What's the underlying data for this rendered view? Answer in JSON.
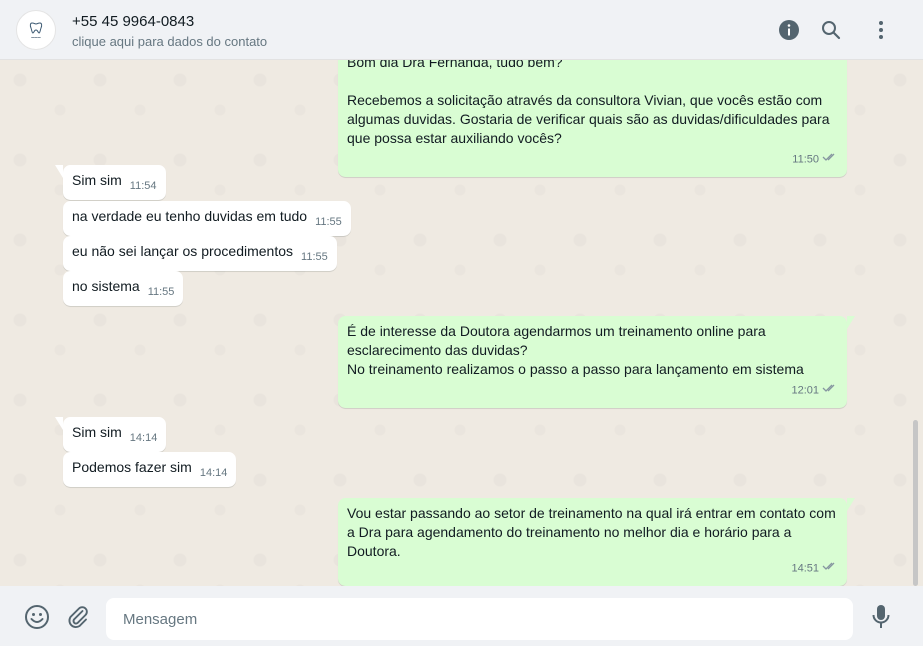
{
  "header": {
    "contact_name": "+55 45 9964-0843",
    "contact_subtitle": "clique aqui para dados do contato",
    "avatar_icon": "tooth-logo",
    "icons": [
      "info-icon",
      "search-icon",
      "menu-dots-icon"
    ]
  },
  "messages": [
    {
      "dir": "out",
      "text": "Bom dia Dra Fernanda, tudo bem?\n\nRecebemos a solicitação através da consultora Vivian, que vocês estão com algumas duvidas. Gostaria de verificar quais são as duvidas/dificuldades para que possa estar auxiliando vocês?",
      "time": "11:50"
    },
    {
      "dir": "in",
      "text": "Sim sim",
      "time": "11:54"
    },
    {
      "dir": "in",
      "text": "na verdade eu tenho duvidas em tudo",
      "time": "11:55"
    },
    {
      "dir": "in",
      "text": "eu não sei lançar os procedimentos",
      "time": "11:55"
    },
    {
      "dir": "in",
      "text": "no sistema",
      "time": "11:55"
    },
    {
      "dir": "out",
      "text": "É de interesse da Doutora agendarmos um treinamento online para esclarecimento das duvidas?\nNo treinamento realizamos o passo a passo para lançamento em sistema",
      "time": "12:01"
    },
    {
      "dir": "in",
      "text": "Sim sim",
      "time": "14:14"
    },
    {
      "dir": "in",
      "text": "Podemos fazer sim",
      "time": "14:14"
    },
    {
      "dir": "out",
      "text": "Vou estar passando ao setor de treinamento na qual irá entrar em contato com a Dra para agendamento do treinamento no melhor dia e horário para a Doutora.",
      "time": "14:51"
    }
  ],
  "footer": {
    "placeholder": "Mensagem",
    "icons": [
      "emoji-icon",
      "attach-icon",
      "mic-icon"
    ]
  },
  "colors": {
    "chat_bg": "#efeae2",
    "outgoing_bubble": "#d9fdd3",
    "incoming_bubble": "#ffffff",
    "header_bg": "#f0f2f5",
    "read_ticks": "#8696a0"
  }
}
